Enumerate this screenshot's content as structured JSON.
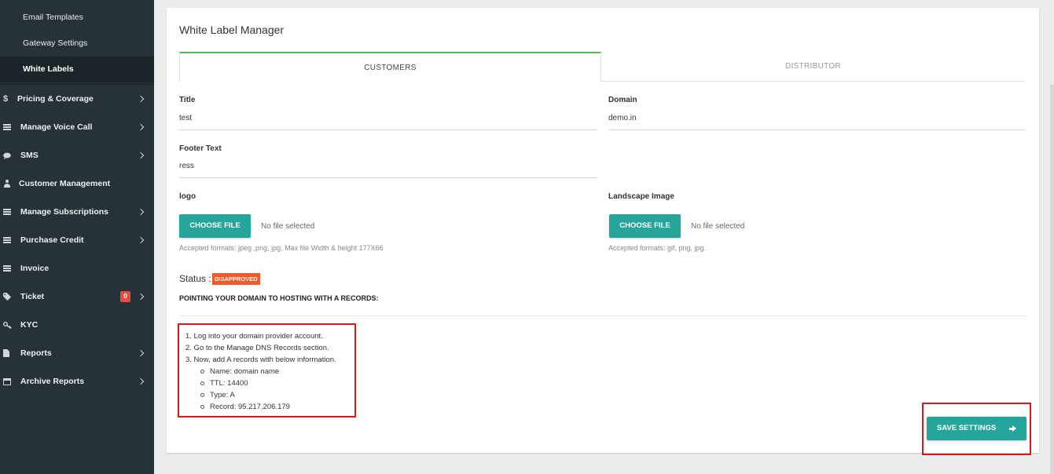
{
  "sidebar": {
    "sub_items": [
      {
        "label": "Email Templates"
      },
      {
        "label": "Gateway Settings"
      },
      {
        "label": "White Labels"
      }
    ],
    "items": [
      {
        "label": "Pricing & Coverage",
        "icon": "dollar-icon"
      },
      {
        "label": "Manage Voice Call",
        "icon": "list-icon"
      },
      {
        "label": "SMS",
        "icon": "comment-icon"
      },
      {
        "label": "Customer Management",
        "icon": "user-icon"
      },
      {
        "label": "Manage Subscriptions",
        "icon": "list-icon"
      },
      {
        "label": "Purchase Credit",
        "icon": "list-icon"
      },
      {
        "label": "Invoice",
        "icon": "list-icon"
      },
      {
        "label": "Ticket",
        "icon": "tag-icon",
        "badge": "0"
      },
      {
        "label": "KYC",
        "icon": "key-icon"
      },
      {
        "label": "Reports",
        "icon": "file-icon"
      },
      {
        "label": "Archive Reports",
        "icon": "calendar-icon"
      }
    ]
  },
  "page": {
    "title": "White Label Manager",
    "tabs": [
      {
        "label": "CUSTOMERS",
        "active": true
      },
      {
        "label": "DISTRIBUTOR",
        "active": false
      }
    ]
  },
  "form": {
    "title_label": "Title",
    "title_value": "test",
    "domain_label": "Domain",
    "domain_value": "demo.in",
    "footer_label": "Footer Text",
    "footer_value": "ress",
    "logo_label": "logo",
    "landscape_label": "Landscape Image",
    "choose_file_label": "CHOOSE FILE",
    "no_file_text": "No file selected",
    "logo_hint": "Accepted formats: jpeg ,png, jpg. Max file Width & height 177X66",
    "landscape_hint": "Accepted formats: gif, png, jpg."
  },
  "status": {
    "label": "Status :",
    "badge": "DISAPPROVED",
    "badge_color": "#f0592a"
  },
  "dns": {
    "heading": "POINTING YOUR DOMAIN TO HOSTING WITH A RECORDS:",
    "steps": [
      "1. Log into your domain provider account.",
      "2. Go to the Manage DNS Records section.",
      "3. Now, add A records with below information."
    ],
    "records": [
      "Name: domain name",
      "TTL: 14400",
      "Type: A",
      "Record: 95.217.206.179"
    ]
  },
  "actions": {
    "save_label": "SAVE SETTINGS"
  },
  "colors": {
    "sidebar_bg": "#263238",
    "accent_teal": "#26a69a",
    "tab_active_border": "#5cb85c",
    "highlight_red": "#d31919"
  }
}
